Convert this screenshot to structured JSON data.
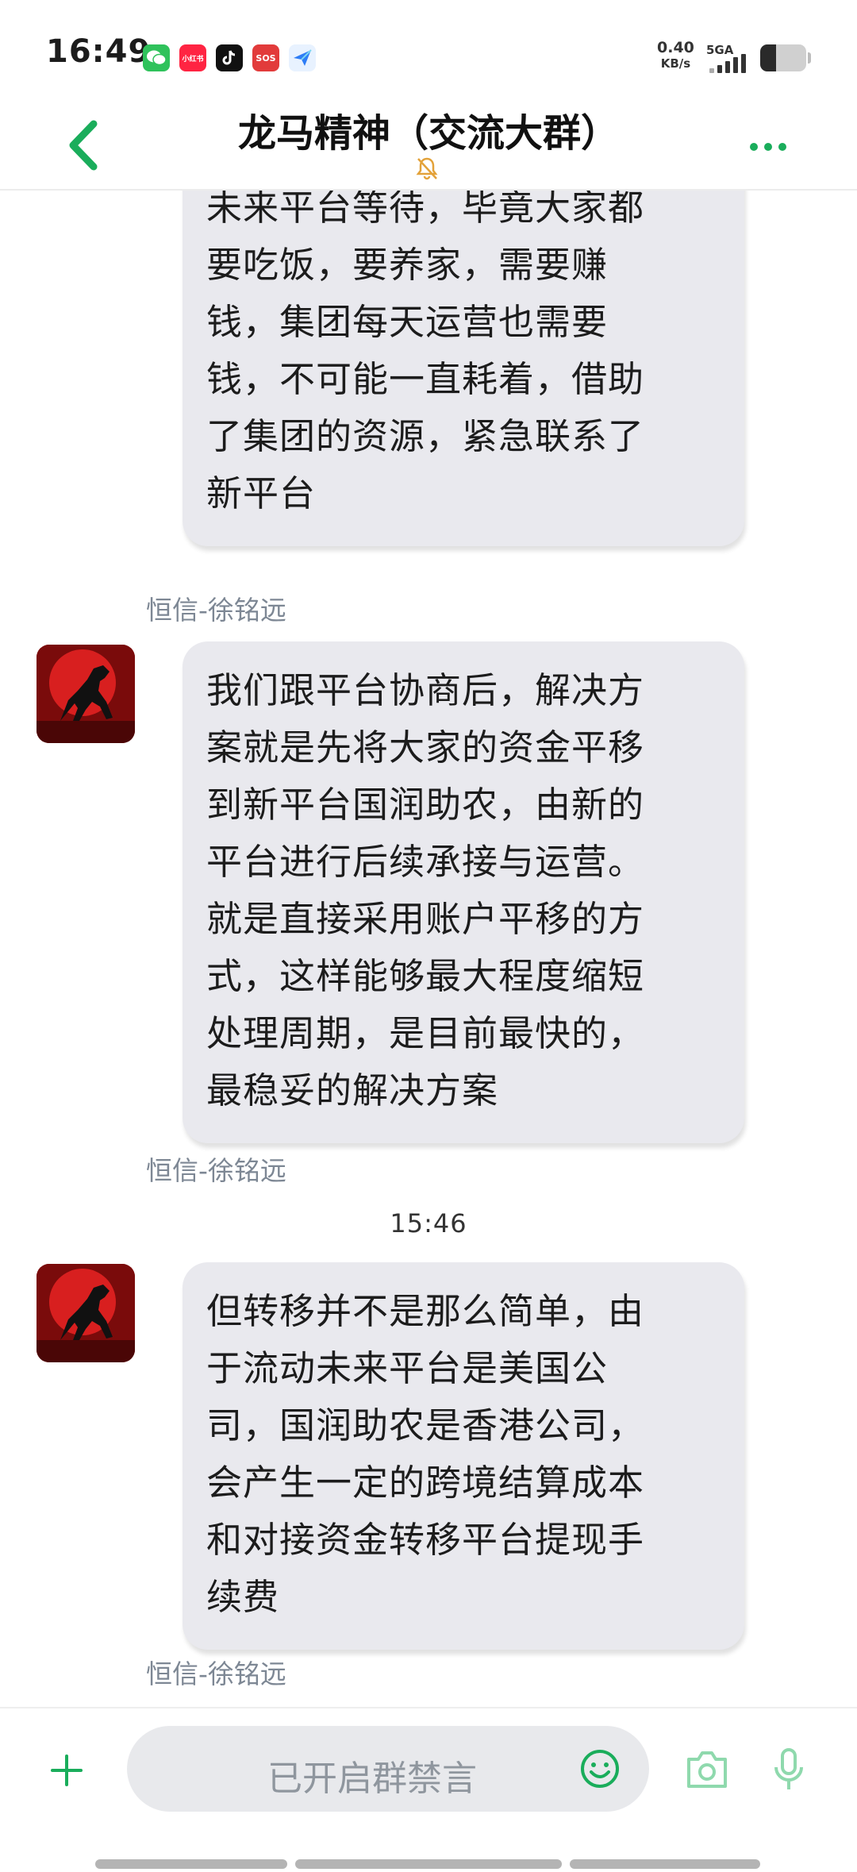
{
  "status_bar": {
    "time": "16:49",
    "net_speed_value": "0.40",
    "net_speed_unit": "KB/s",
    "network_type": "5GA",
    "notification_icons": [
      "wechat-icon",
      "xiaohongshu-icon",
      "tiktok-icon",
      "sos-icon",
      "feishu-icon"
    ],
    "notif_xhs_label": "小红书",
    "notif_sos_label": "SOS"
  },
  "header": {
    "title": "龙马精神（交流大群）",
    "back_icon": "chevron-left-icon",
    "mute_icon": "bell-muted-icon",
    "more_icon": "more-dots-icon"
  },
  "messages": [
    {
      "sender": "恒信-徐铭远",
      "avatar": "red-horse-avatar",
      "text": "拍板决定，不再陪同跟流动\n未来平台等待，毕竟大家都\n要吃饭，要养家，需要赚\n钱，集团每天运营也需要\n钱，不可能一直耗着，借助\n了集团的资源，紧急联系了\n新平台"
    },
    {
      "sender": "恒信-徐铭远",
      "avatar": "red-horse-avatar",
      "text": "我们跟平台协商后，解决方\n案就是先将大家的资金平移\n到新平台国润助农，由新的\n平台进行后续承接与运营。\n就是直接采用账户平移的方\n式，这样能够最大程度缩短\n处理周期，是目前最快的，\n最稳妥的解决方案"
    },
    {
      "sender": "恒信-徐铭远",
      "avatar": "red-horse-avatar",
      "text": "但转移并不是那么简单，由\n于流动未来平台是美国公\n司，国润助农是香港公司，\n会产生一定的跨境结算成本\n和对接资金转移平台提现手\n续费"
    }
  ],
  "timestamp": "15:46",
  "input_bar": {
    "placeholder": "已开启群禁言",
    "plus_icon": "plus-icon",
    "emoji_icon": "emoji-icon",
    "camera_icon": "camera-icon",
    "mic_icon": "microphone-icon"
  },
  "colors": {
    "accent": "#1aad5b",
    "bubble": "#e9e9ee",
    "muted_text": "#7d8794",
    "mute_bell": "#e3a23a"
  }
}
